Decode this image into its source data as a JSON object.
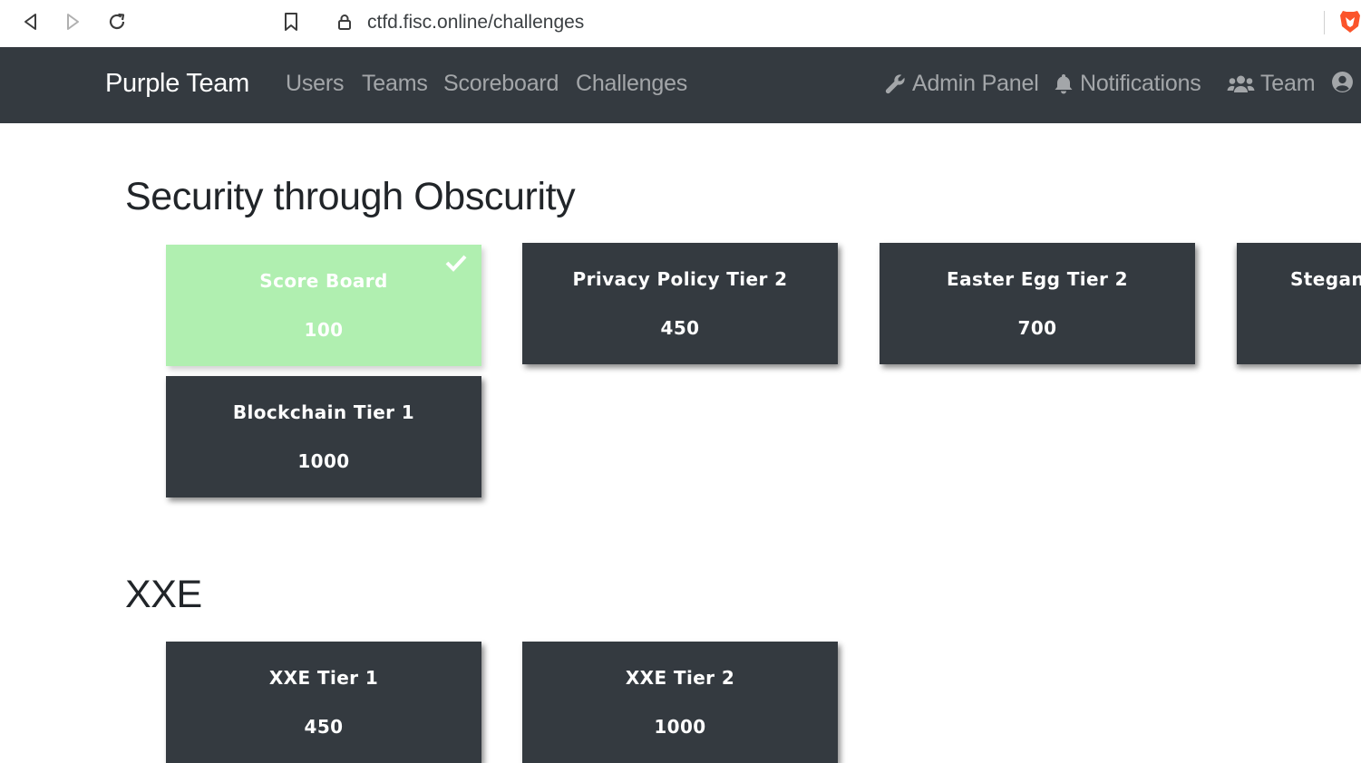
{
  "browser": {
    "url": "ctfd.fisc.online/challenges"
  },
  "navbar": {
    "brand": "Purple Team",
    "links": [
      "Users",
      "Teams",
      "Scoreboard",
      "Challenges"
    ],
    "right": {
      "admin_panel": "Admin Panel",
      "notifications": "Notifications",
      "team": "Team"
    }
  },
  "categories": [
    {
      "title": "Security through Obscurity",
      "challenges": [
        {
          "name": "Score Board",
          "value": "100",
          "solved": true
        },
        {
          "name": "Privacy Policy Tier 2",
          "value": "450",
          "solved": false
        },
        {
          "name": "Easter Egg Tier 2",
          "value": "700",
          "solved": false
        },
        {
          "name": "Stegano",
          "value": "",
          "solved": false
        },
        {
          "name": "Blockchain Tier 1",
          "value": "1000",
          "solved": false
        }
      ]
    },
    {
      "title": "XXE",
      "challenges": [
        {
          "name": "XXE Tier 1",
          "value": "450",
          "solved": false
        },
        {
          "name": "XXE Tier 2",
          "value": "1000",
          "solved": false
        }
      ]
    }
  ],
  "colors": {
    "navbar_bg": "#343a40",
    "card_bg": "#343a40",
    "solved_bg": "#b0efb0",
    "brave_orange": "#fb542b"
  },
  "icons": {
    "back": "back-arrow-icon",
    "forward": "forward-arrow-icon",
    "reload": "reload-icon",
    "bookmark": "bookmark-icon",
    "lock": "lock-icon",
    "brave": "brave-lion-icon",
    "wrench": "wrench-icon",
    "bell": "bell-icon",
    "users": "users-icon",
    "user_circle": "user-circle-icon",
    "check": "check-icon"
  }
}
